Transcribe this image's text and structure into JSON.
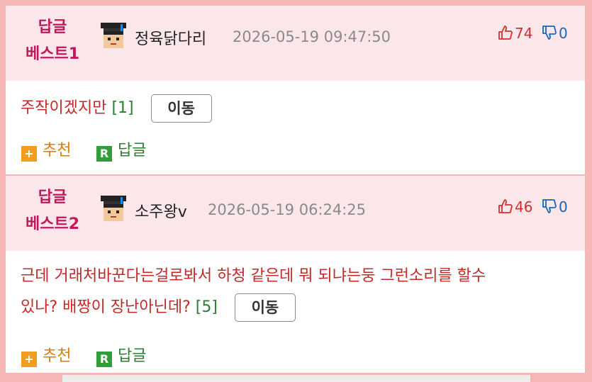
{
  "comments": [
    {
      "badge_line1": "답글",
      "badge_line2": "베스트1",
      "nickname": "정육닭다리",
      "datetime": "2026-05-19 09:47:50",
      "likes": "74",
      "dislikes": "0",
      "text_lines": [
        "주작이겠지만"
      ],
      "reply_count": "[1]",
      "move_label": "이동",
      "recommend_label": "추천",
      "reply_label": "답글"
    },
    {
      "badge_line1": "답글",
      "badge_line2": "베스트2",
      "nickname": "소주왕v",
      "datetime": "2026-05-19 06:24:25",
      "likes": "46",
      "dislikes": "0",
      "text_lines": [
        "근데 거래처바꾼다는걸로봐서 하청 같은데 뭐 되냐는둥 그런소리를 할수",
        "있나? 배짱이 장난아닌데?"
      ],
      "reply_count": "[5]",
      "move_label": "이동",
      "recommend_label": "추천",
      "reply_label": "답글"
    }
  ],
  "icons": {
    "avatar": "scholar-avatar-icon",
    "like": "thumbs-up-icon",
    "dislike": "thumbs-down-icon",
    "recommend": "plus-icon",
    "reply": "reply-r-icon"
  },
  "icon_glyphs": {
    "plus": "+",
    "reply": "R"
  },
  "colors": {
    "badge": "#c2185b",
    "header_bg": "#fbe7e9",
    "comment_text": "#c62828",
    "reply_count": "#2e7d32",
    "like": "#d32f2f",
    "dislike": "#1565c0",
    "recommend": "#e07a00"
  }
}
